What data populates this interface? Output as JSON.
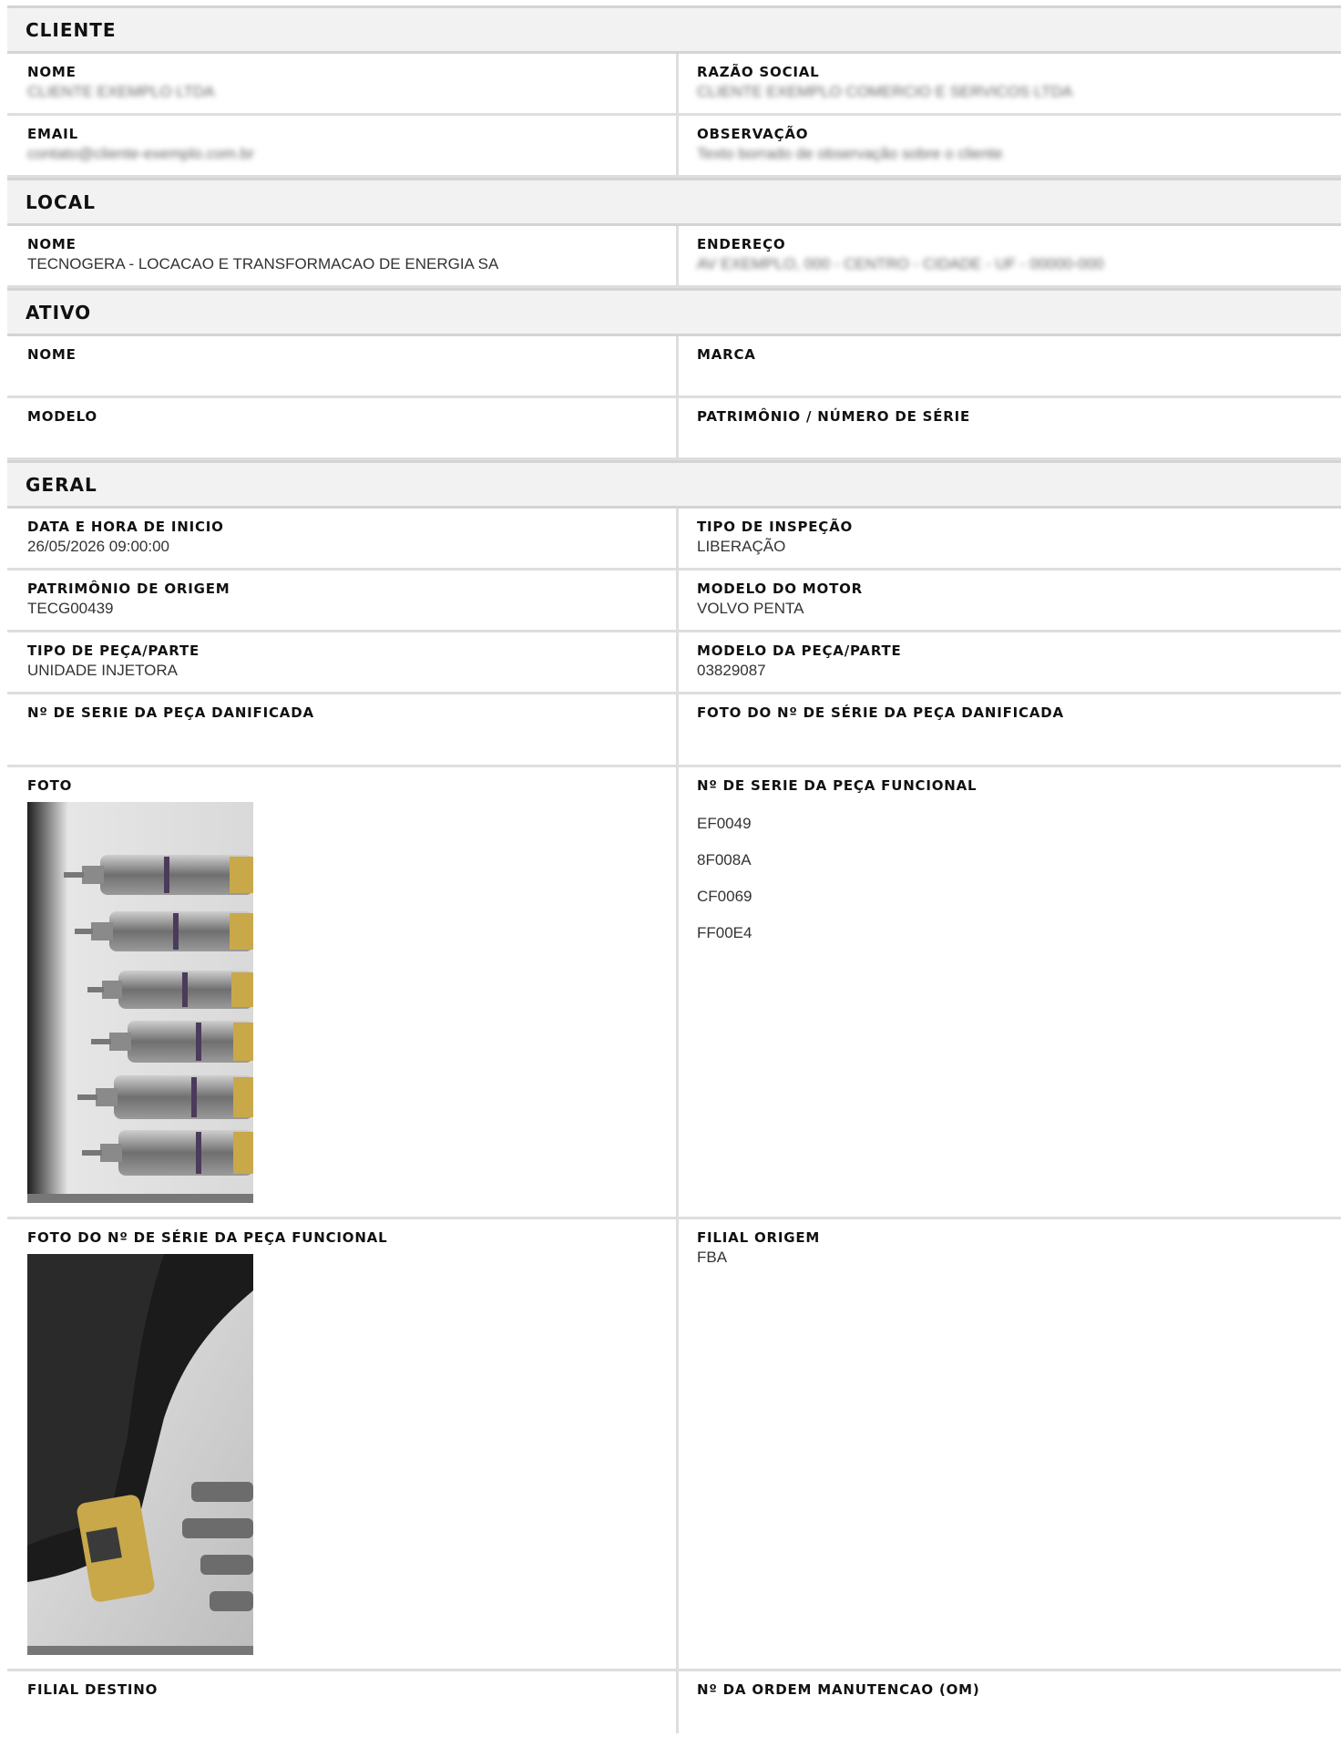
{
  "cliente": {
    "title": "CLIENTE",
    "nome_label": "NOME",
    "nome_value": "CLIENTE EXEMPLO LTDA",
    "razao_label": "RAZÃO SOCIAL",
    "razao_value": "CLIENTE EXEMPLO COMERCIO E SERVICOS LTDA",
    "email_label": "EMAIL",
    "email_value": "contato@cliente-exemplo.com.br",
    "obs_label": "OBSERVAÇÃO",
    "obs_value": "Texto borrado de observação sobre o cliente"
  },
  "local": {
    "title": "LOCAL",
    "nome_label": "NOME",
    "nome_value": "TECNOGERA - LOCACAO E TRANSFORMACAO DE ENERGIA SA",
    "endereco_label": "ENDEREÇO",
    "endereco_value": "AV EXEMPLO, 000 - CENTRO - CIDADE - UF - 00000-000"
  },
  "ativo": {
    "title": "ATIVO",
    "nome_label": "NOME",
    "marca_label": "MARCA",
    "modelo_label": "MODELO",
    "patrimonio_label": "PATRIMÔNIO / NÚMERO DE SÉRIE"
  },
  "geral": {
    "title": "GERAL",
    "data_label": "DATA E HORA DE INICIO",
    "data_value": "26/05/2026 09:00:00",
    "tipo_inspecao_label": "TIPO DE INSPEÇÃO",
    "tipo_inspecao_value": "LIBERAÇÃO",
    "patrimonio_origem_label": "PATRIMÔNIO DE ORIGEM",
    "patrimonio_origem_value": "TECG00439",
    "modelo_motor_label": "MODELO DO MOTOR",
    "modelo_motor_value": "VOLVO PENTA",
    "tipo_peca_label": "TIPO DE PEÇA/PARTE",
    "tipo_peca_value": "UNIDADE INJETORA",
    "modelo_peca_label": "MODELO DA PEÇA/PARTE",
    "modelo_peca_value": "03829087",
    "serie_danificada_label": "Nº DE SERIE DA PEÇA DANIFICADA",
    "foto_serie_danificada_label": "FOTO DO Nº DE SÉRIE DA PEÇA DANIFICADA",
    "foto_label": "FOTO",
    "serie_funcional_label": "Nº DE SERIE DA PEÇA FUNCIONAL",
    "serie_funcional_values": [
      "EF0049",
      "8F008A",
      "CF0069",
      "FF00E4"
    ],
    "foto_serie_funcional_label": "FOTO DO Nº DE SÉRIE DA PEÇA FUNCIONAL",
    "filial_origem_label": "FILIAL ORIGEM",
    "filial_origem_value": "FBA",
    "filial_destino_label": "FILIAL DESTINO",
    "om_label": "Nº DA ORDEM MANUTENCAO (OM)"
  }
}
